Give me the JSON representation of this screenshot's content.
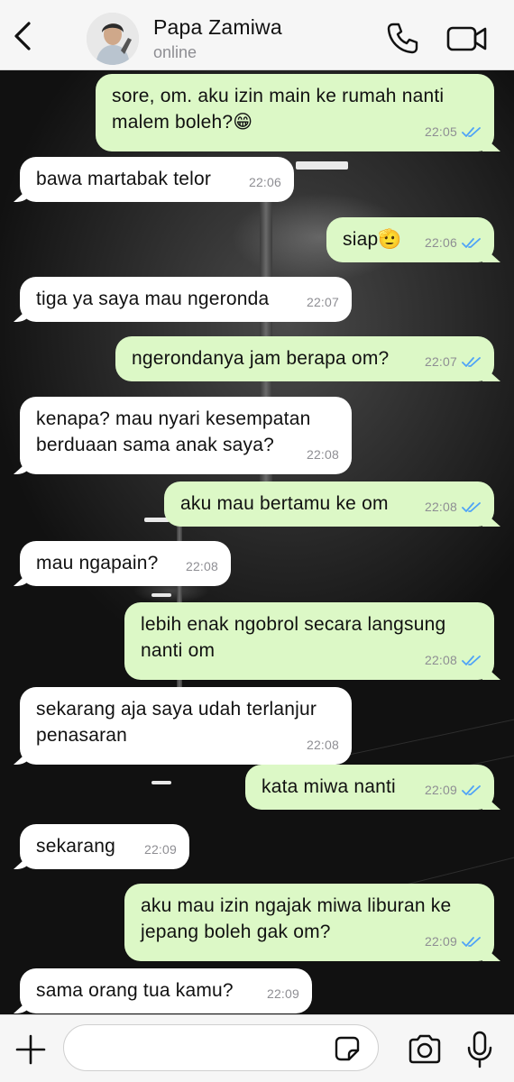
{
  "header": {
    "contact_name": "Papa Zamiwa",
    "status": "online",
    "back_icon": "chevron-left-icon",
    "call_icon": "phone-icon",
    "video_icon": "video-camera-icon"
  },
  "messages": [
    {
      "direction": "out",
      "text": "sore, om. aku izin main ke rumah nanti\nmalem boleh?😁",
      "time": "22:05",
      "read": true
    },
    {
      "direction": "in",
      "text": "bawa martabak telor",
      "time": "22:06"
    },
    {
      "direction": "out",
      "text": "siap🫡",
      "time": "22:06",
      "read": true
    },
    {
      "direction": "in",
      "text": "tiga ya saya mau ngeronda",
      "time": "22:07"
    },
    {
      "direction": "out",
      "text": "ngerondanya jam berapa om?",
      "time": "22:07",
      "read": true
    },
    {
      "direction": "in",
      "text": "kenapa? mau nyari kesempatan\nberduaan sama anak saya?",
      "time": "22:08"
    },
    {
      "direction": "out",
      "text": "aku mau bertamu ke om",
      "time": "22:08",
      "read": true
    },
    {
      "direction": "in",
      "text": "mau ngapain?",
      "time": "22:08"
    },
    {
      "direction": "out",
      "text": "lebih enak ngobrol secara langsung\nnanti om",
      "time": "22:08",
      "read": true
    },
    {
      "direction": "in",
      "text": "sekarang aja saya udah terlanjur\npenasaran",
      "time": "22:08"
    },
    {
      "direction": "out",
      "text": "kata miwa nanti",
      "time": "22:09",
      "read": true
    },
    {
      "direction": "in",
      "text": "sekarang",
      "time": "22:09"
    },
    {
      "direction": "out",
      "text": "aku mau izin ngajak miwa liburan ke\njepang boleh gak om?",
      "time": "22:09",
      "read": true
    },
    {
      "direction": "in",
      "text": "sama orang tua kamu?",
      "time": "22:09"
    }
  ],
  "composer": {
    "placeholder": "",
    "plus_icon": "plus-icon",
    "sticker_icon": "sticker-icon",
    "camera_icon": "camera-icon",
    "mic_icon": "microphone-icon"
  },
  "colors": {
    "outgoing_bubble": "#dcf8c6",
    "incoming_bubble": "#ffffff",
    "read_ticks": "#4fa3f7",
    "header_bg": "#f6f6f6"
  }
}
